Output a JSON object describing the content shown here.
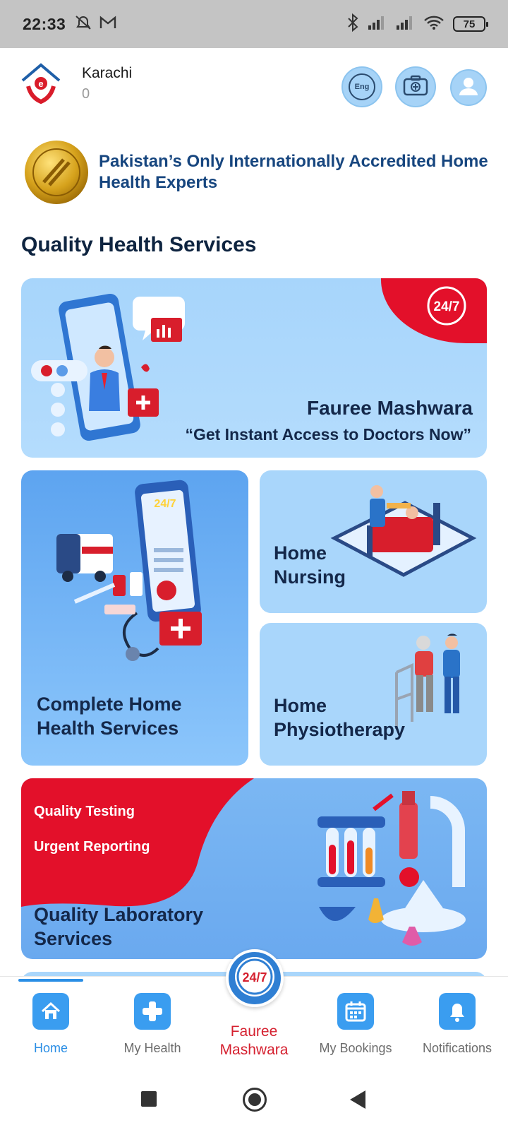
{
  "status_bar": {
    "time": "22:33",
    "battery": "75",
    "icons": [
      "mute-alarm-icon",
      "gmail-icon",
      "bluetooth-icon",
      "signal-icon",
      "signal-icon",
      "wifi-icon",
      "battery-icon"
    ]
  },
  "header": {
    "city": "Karachi",
    "sub_value": "0",
    "lang_button": "Eng",
    "icons": [
      "app-logo",
      "language-icon",
      "medical-kit-icon",
      "profile-icon"
    ]
  },
  "accreditation": {
    "text": "Pakistan’s Only Internationally Accredited Home Health Experts"
  },
  "main": {
    "section_title": "Quality Health Services",
    "faure_card": {
      "badge": "24/7",
      "title": "Fauree Mashwara",
      "subtitle": "“Get Instant Access to Doctors Now”"
    },
    "complete_card": {
      "line1": "Complete Home",
      "line2": "Health Services"
    },
    "nursing_card": {
      "line1": "Home",
      "line2": "Nursing"
    },
    "physio_card": {
      "line1": "Home",
      "line2": "Physiotherapy"
    },
    "lab_card": {
      "tag1": "Quality Testing",
      "tag2": "Urgent Reporting",
      "line1": "Quality Laboratory",
      "line2": "Services"
    }
  },
  "bottom_nav": {
    "items": [
      {
        "label": "Home",
        "icon": "home-icon",
        "active": true
      },
      {
        "label": "My Health",
        "icon": "plus-icon",
        "active": false
      },
      {
        "label": "Fauree Mashwara",
        "icon": "24-7-icon",
        "active": false
      },
      {
        "label": "My Bookings",
        "icon": "calendar-icon",
        "active": false
      },
      {
        "label": "Notifications",
        "icon": "bell-icon",
        "active": false
      }
    ],
    "center_line1": "Fauree",
    "center_line2": "Mashwara"
  },
  "colors": {
    "accent": "#2a8ee5",
    "brand_red": "#e3102a",
    "card_blue": "#a9d6fb",
    "title_dark": "#14284a"
  }
}
